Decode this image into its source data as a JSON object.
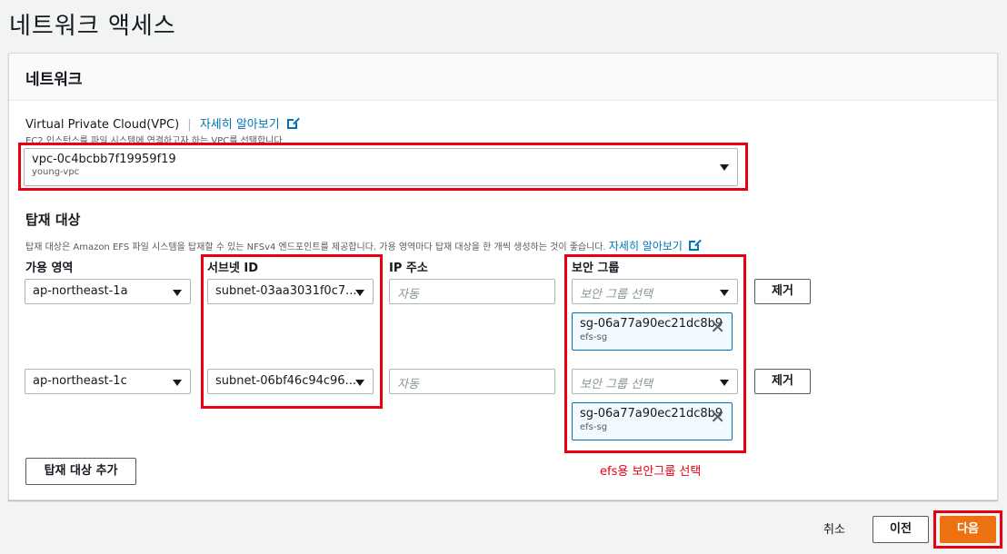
{
  "page": {
    "title": "네트워크 액세스"
  },
  "network": {
    "header": "네트워크",
    "vpc_label": "Virtual Private Cloud(VPC)",
    "vpc_link": "자세히 알아보기",
    "vpc_desc": "EC2 인스턴스를 파일 시스템에 연결하고자 하는 VPC를 선택합니다.",
    "vpc_value": "vpc-0c4bcbb7f19959f19",
    "vpc_sub": "young-vpc"
  },
  "mount": {
    "title": "탑재 대상",
    "desc": "탑재 대상은 Amazon EFS 파일 시스템을 탑재할 수 있는 NFSv4 엔드포인트를 제공합니다. 가용 영역마다 탑재 대상을 한 개씩 생성하는 것이 좋습니다.",
    "desc_link": "자세히 알아보기",
    "col_az": "가용 영역",
    "col_subnet": "서브넷 ID",
    "col_ip": "IP 주소",
    "col_sg": "보안 그룹",
    "rows": [
      {
        "az": "ap-northeast-1a",
        "subnet": "subnet-03aa3031f0c7...",
        "ip_placeholder": "자동",
        "sg_placeholder": "보안 그룹 선택",
        "sg_token": "sg-06a77a90ec21dc8b9",
        "sg_token_sub": "efs-sg",
        "remove": "제거"
      },
      {
        "az": "ap-northeast-1c",
        "subnet": "subnet-06bf46c94c96...",
        "ip_placeholder": "자동",
        "sg_placeholder": "보안 그룹 선택",
        "sg_token": "sg-06a77a90ec21dc8b9",
        "sg_token_sub": "efs-sg",
        "remove": "제거"
      }
    ],
    "add_button": "탑재 대상 추가",
    "annotation": "efs용 보안그룹 선택"
  },
  "footer": {
    "cancel": "취소",
    "prev": "이전",
    "next": "다음"
  },
  "colors": {
    "accent": "#0073bb",
    "primary": "#ec7211",
    "highlight": "#e60012"
  },
  "icons": [
    "external-link-icon",
    "caret-down-icon",
    "close-icon"
  ]
}
